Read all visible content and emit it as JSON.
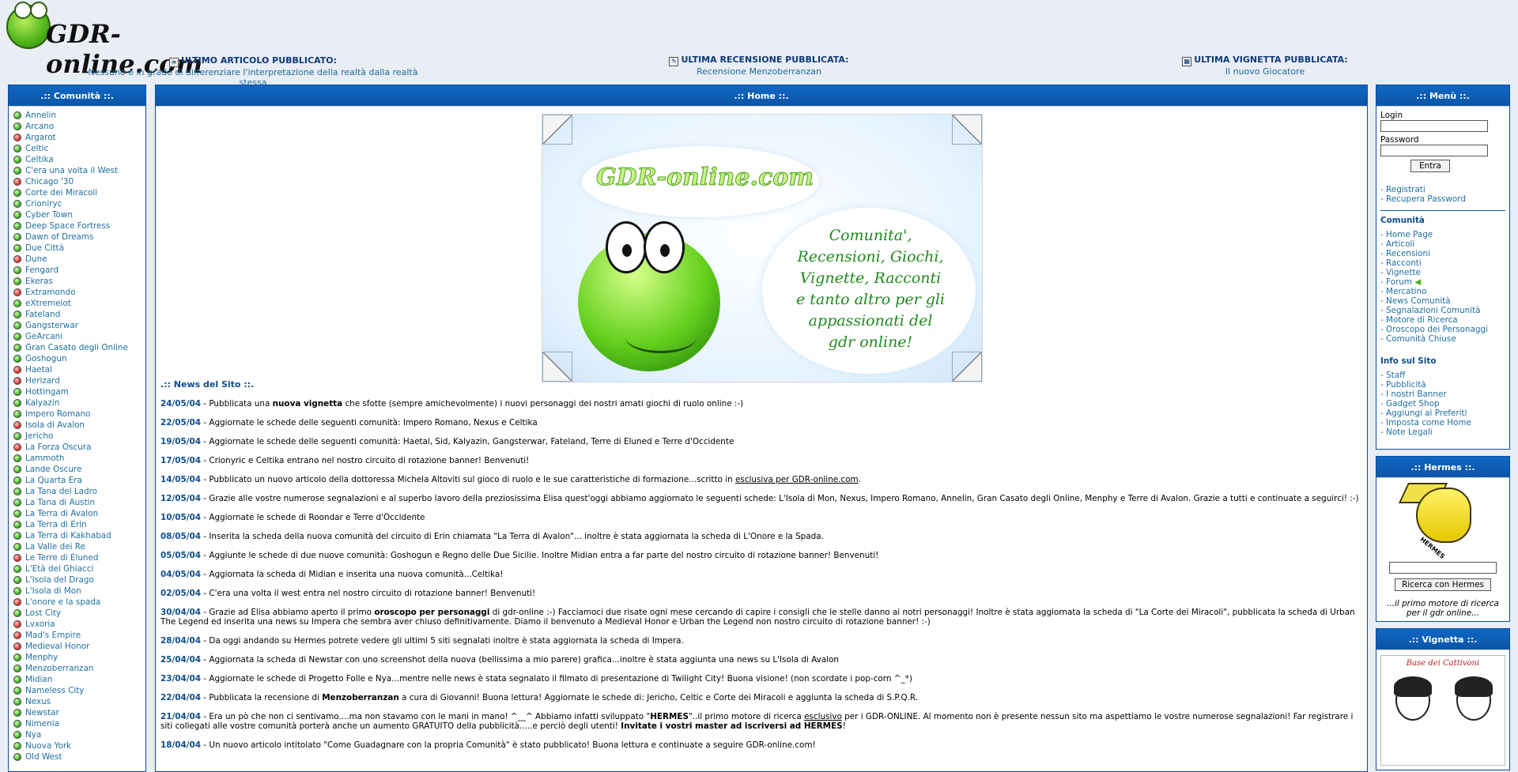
{
  "header": {
    "logo_text": "GDR-online.com",
    "latest": [
      {
        "title": "ULTIMO ARTICOLO PUBBLICATO:",
        "value": "Nessuno è in grado di differenziare l'interpretazione della realtà dalla realtà stessa",
        "icon": "article-icon"
      },
      {
        "title": "ULTIMA RECENSIONE PUBBLICATA:",
        "value": "Recensione Menzoberranzan",
        "icon": "review-icon"
      },
      {
        "title": "ULTIMA VIGNETTA PUBBLICATA:",
        "value": "Il nuovo Giocatore",
        "icon": "cartoon-icon"
      }
    ]
  },
  "left": {
    "title": ".:: Comunità ::.",
    "items": [
      {
        "label": "Annelin",
        "status": "green"
      },
      {
        "label": "Arcano",
        "status": "green"
      },
      {
        "label": "Argarot",
        "status": "red"
      },
      {
        "label": "Celtic",
        "status": "green"
      },
      {
        "label": "Celtika",
        "status": "green"
      },
      {
        "label": "C'era una volta il West",
        "status": "green"
      },
      {
        "label": "Chicago '30",
        "status": "red"
      },
      {
        "label": "Corte dei Miracoli",
        "status": "green"
      },
      {
        "label": "Crioniryc",
        "status": "green"
      },
      {
        "label": "Cyber Town",
        "status": "green"
      },
      {
        "label": "Deep Space Fortress",
        "status": "green"
      },
      {
        "label": "Dawn of Dreams",
        "status": "green"
      },
      {
        "label": "Due Città",
        "status": "green"
      },
      {
        "label": "Dune",
        "status": "red"
      },
      {
        "label": "Fengard",
        "status": "green"
      },
      {
        "label": "Ekeras",
        "status": "green"
      },
      {
        "label": "Extramondo",
        "status": "red"
      },
      {
        "label": "eXtremelot",
        "status": "green"
      },
      {
        "label": "Fateland",
        "status": "green"
      },
      {
        "label": "Gangsterwar",
        "status": "green"
      },
      {
        "label": "GeArcani",
        "status": "green"
      },
      {
        "label": "Gran Casato degli Online",
        "status": "green"
      },
      {
        "label": "Goshogun",
        "status": "green"
      },
      {
        "label": "Haetal",
        "status": "red"
      },
      {
        "label": "Herizard",
        "status": "red"
      },
      {
        "label": "Hottingam",
        "status": "green"
      },
      {
        "label": "Kalyazin",
        "status": "green"
      },
      {
        "label": "Impero Romano",
        "status": "green"
      },
      {
        "label": "Isola di Avalon",
        "status": "red"
      },
      {
        "label": "Jericho",
        "status": "green"
      },
      {
        "label": "La Forza Oscura",
        "status": "red"
      },
      {
        "label": "Lammoth",
        "status": "green"
      },
      {
        "label": "Lande Oscure",
        "status": "green"
      },
      {
        "label": "La Quarta Era",
        "status": "green"
      },
      {
        "label": "La Tana del Ladro",
        "status": "green"
      },
      {
        "label": "La Tana di Austin",
        "status": "green"
      },
      {
        "label": "La Terra di Avalon",
        "status": "green"
      },
      {
        "label": "La Terra di Erin",
        "status": "green"
      },
      {
        "label": "La Terra di Kakhabad",
        "status": "green"
      },
      {
        "label": "La Valle dei Re",
        "status": "green"
      },
      {
        "label": "Le Terre di Eluned",
        "status": "red"
      },
      {
        "label": "L'Età dei Ghiacci",
        "status": "green"
      },
      {
        "label": "L'Isola del Drago",
        "status": "green"
      },
      {
        "label": "L'Isola di Mon",
        "status": "green"
      },
      {
        "label": "L'onore e la spada",
        "status": "red"
      },
      {
        "label": "Lost City",
        "status": "green"
      },
      {
        "label": "Lvxoria",
        "status": "red"
      },
      {
        "label": "Mad's Empire",
        "status": "red"
      },
      {
        "label": "Medieval Honor",
        "status": "red"
      },
      {
        "label": "Menphy",
        "status": "green"
      },
      {
        "label": "Menzoberranzan",
        "status": "green"
      },
      {
        "label": "Midian",
        "status": "green"
      },
      {
        "label": "Nameless City",
        "status": "green"
      },
      {
        "label": "Nexus",
        "status": "green"
      },
      {
        "label": "Newstar",
        "status": "green"
      },
      {
        "label": "Nimenia",
        "status": "green"
      },
      {
        "label": "Nya",
        "status": "green"
      },
      {
        "label": "Nuova York",
        "status": "green"
      },
      {
        "label": "Old West",
        "status": "green"
      }
    ]
  },
  "main": {
    "title": ".:: Home ::.",
    "banner": {
      "title": "GDR-online.com",
      "tagline": [
        "Comunita',",
        "Recensioni, Giochi,",
        "Vignette, Racconti",
        "e tanto altro per gli",
        "appassionati del",
        "gdr online!"
      ]
    },
    "news_title": ".:: News del Sito ::.",
    "news": [
      {
        "date": "24/05/04",
        "parts": [
          [
            "t",
            " - Pubblicata una "
          ],
          [
            "b",
            "nuova vignetta"
          ],
          [
            "t",
            " che sfotte (sempre amichevolmente) i nuovi personaggi dei nostri amati giochi di ruolo online :-)"
          ]
        ]
      },
      {
        "date": "22/05/04",
        "parts": [
          [
            "t",
            " - Aggiornate le schede delle seguenti comunità: Impero Romano, Nexus e Celtika"
          ]
        ]
      },
      {
        "date": "19/05/04",
        "parts": [
          [
            "t",
            " - Aggiornate le schede delle seguenti comunità: Haetal, Sid, Kalyazin, Gangsterwar, Fateland, Terre di Eluned e Terre d'Occidente"
          ]
        ]
      },
      {
        "date": "17/05/04",
        "parts": [
          [
            "t",
            " - Crionyric e Celtika entrano nel nostro circuito di rotazione banner! Benvenuti!"
          ]
        ]
      },
      {
        "date": "14/05/04",
        "parts": [
          [
            "t",
            " - Pubblicato un nuovo articolo della dottoressa Michela Altoviti sul gioco di ruolo e le sue caratteristiche di formazione...scritto in "
          ],
          [
            "u",
            "esclusiva per GDR-online.com"
          ],
          [
            "t",
            "."
          ]
        ]
      },
      {
        "date": "12/05/04",
        "parts": [
          [
            "t",
            " - Grazie alle vostre numerose segnalazioni e al superbo lavoro della preziosissima Elisa quest'oggi abbiamo aggiornato le seguenti schede: L'Isola di Mon, Nexus, Impero Romano, Annelin, Gran Casato degli Online, Menphy e Terre di Avalon. Grazie a tutti e continuate a seguirci! :-)"
          ]
        ]
      },
      {
        "date": "10/05/04",
        "parts": [
          [
            "t",
            " - Aggiornate le schede di Roondar e Terre d'Occidente"
          ]
        ]
      },
      {
        "date": "08/05/04",
        "parts": [
          [
            "t",
            " - Inserita la scheda della nuova comunità del circuito di Erin chiamata \"La Terra di Avalon\"... inoltre è stata aggiornata la scheda di L'Onore e la Spada."
          ]
        ]
      },
      {
        "date": "05/05/04",
        "parts": [
          [
            "t",
            " - Aggiunte le schede di due nuove comunità: Goshogun e Regno delle Due Sicilie. Inoltre Midian entra a far parte del nostro circuito di rotazione banner! Benvenuti!"
          ]
        ]
      },
      {
        "date": "04/05/04",
        "parts": [
          [
            "t",
            " - Aggiornata la scheda di Midian e inserita una nuova comunità...Celtika!"
          ]
        ]
      },
      {
        "date": "02/05/04",
        "parts": [
          [
            "t",
            " - C'era una volta il west entra nel nostro circuito di rotazione banner! Benvenuti!"
          ]
        ]
      },
      {
        "date": "30/04/04",
        "parts": [
          [
            "t",
            " - Grazie ad Elisa abbiamo aperto il primo "
          ],
          [
            "b",
            "oroscopo per personaggi"
          ],
          [
            "t",
            " di gdr-online :-) Facciamoci due risate ogni mese cercando di capire i consigli che le stelle danno ai notri personaggi! Inoltre è stata aggiornata la scheda di \"La Corte dei Miracoli\", pubblicata la scheda di Urban The Legend ed inserita una news su Impera che sembra aver chiuso definitivamente. Diamo il benvenuto a Medieval Honor e Urban the Legend non nostro circuito di rotazione banner! :-)"
          ]
        ]
      },
      {
        "date": "28/04/04",
        "parts": [
          [
            "t",
            " - Da oggi andando su Hermes potrete vedere gli ultimi 5 siti segnalati inoltre è stata aggiornata la scheda di Impera."
          ]
        ]
      },
      {
        "date": "25/04/04",
        "parts": [
          [
            "t",
            " - Aggiornata la scheda di Newstar con uno screenshot della nuova (bellissima a mio parere) grafica...inoltre è stata aggiunta una news su L'Isola di Avalon"
          ]
        ]
      },
      {
        "date": "23/04/04",
        "parts": [
          [
            "t",
            " - Aggiornate le schede di Progetto Folle e Nya...mentre nelle news è stata segnalato il filmato di presentazione di Twilight City! Buona visione! (non scordate i pop-corn ^_*)"
          ]
        ]
      },
      {
        "date": "22/04/04",
        "parts": [
          [
            "t",
            " - Pubblicata la recensione di "
          ],
          [
            "b",
            "Menzoberranzan"
          ],
          [
            "t",
            " a cura di Giovanni! Buona lettura! Aggiornate le schede di: Jericho, Celtic e Corte dei Miracoli e aggiunta la scheda di S.P.Q.R."
          ]
        ]
      },
      {
        "date": "21/04/04",
        "parts": [
          [
            "t",
            " - Era un pò che non ci sentivamo....ma non stavamo con le mani in mano! ^__^ Abbiamo infatti sviluppato \""
          ],
          [
            "b",
            "HERMES"
          ],
          [
            "t",
            "\"..il primo motore di ricerca "
          ],
          [
            "u",
            "esclusivo"
          ],
          [
            "t",
            " per i GDR-ONLINE. Al momento non è presente nessun sito ma aspettiamo le vostre numerose segnalazioni! Far registrare i siti collegati alle vostre comunità porterà anche un aumento GRATUITO della pubblicità.....e perciò degli utenti! "
          ],
          [
            "b",
            "Invitate i vostri master ad iscriversi ad HERMES"
          ],
          [
            "t",
            "!"
          ]
        ]
      },
      {
        "date": "18/04/04",
        "parts": [
          [
            "t",
            " - Un nuovo articolo intitolato \"Come Guadagnare con la propria Comunità\" è stato pubblicato! Buona lettura e continuate a seguire GDR-online.com!"
          ]
        ]
      }
    ]
  },
  "menu": {
    "title": ".:: Menù ::.",
    "login_label": "Login",
    "password_label": "Password",
    "login_value": "",
    "password_value": "",
    "enter_button": "Entra",
    "account_links": [
      "- Registrati",
      "- Recupera Password"
    ],
    "community_title": "Comunità",
    "community_links": [
      "- Home Page",
      "- Articoli",
      "- Recensioni",
      "- Racconti",
      "- Vignette",
      "- Forum",
      "- Mercatino",
      "- News Comunità",
      "- Segnalazioni Comunità",
      "- Motore di Ricerca",
      "- Oroscopo dei Personaggi",
      "- Comunità Chiuse"
    ],
    "info_title": "Info sul Sito",
    "info_links": [
      "- Staff",
      "- Pubblicità",
      "- I nostri Banner",
      "- Gadget Shop",
      "- Aggiungi ai Preferiti",
      "- Imposta come Home",
      "- Note Legali"
    ]
  },
  "hermes": {
    "title": ".:: Hermes ::.",
    "logo_text": "HERMES",
    "search_value": "",
    "button": "Ricerca con Hermes",
    "caption": "...il primo motore di ricerca per il gdr online..."
  },
  "vignetta": {
    "title": ".:: Vignetta ::.",
    "comic_title": "Base dei Cattivoni"
  }
}
